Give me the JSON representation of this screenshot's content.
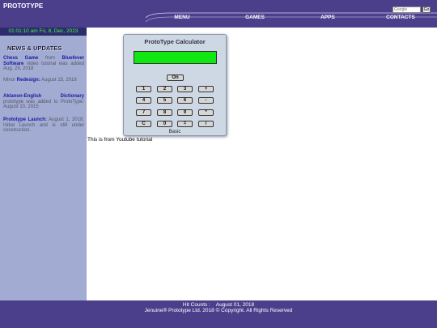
{
  "header": {
    "logo": "PROTOTYPE",
    "search_placeholder": "Google",
    "search_button": "Go",
    "nav": [
      "MENU",
      "GAMES",
      "APPS",
      "CONTACTS"
    ]
  },
  "sidebar": {
    "clock": "01:01:10 am Fri, 8, Dec, 2023",
    "news_title": "NEWS & UPDATES",
    "news": [
      {
        "hl1": "Chess Game",
        "t1": " from ",
        "hl2": "Bluefever Software",
        "t2": " video tutorial was added Aug. 29, 2018"
      },
      {
        "t0": "Minor ",
        "hl1": "Redesign:",
        "t1": " August 15, 2018"
      },
      {
        "hl1": "Aklanon-English Dictionary",
        "t1": " prototype was added to ProtoType: August 10, 2015"
      },
      {
        "hl1": "Prototype Launch:",
        "t1": " August 1, 2018. Initial Launch and is still under construction."
      }
    ]
  },
  "calculator": {
    "title": "ProtoType Calculator",
    "on_label": "On",
    "keys": [
      [
        "1",
        "2",
        "3",
        "+"
      ],
      [
        "4",
        "5",
        "6",
        "-"
      ],
      [
        "7",
        "8",
        "9",
        "*"
      ],
      [
        "C",
        "0",
        "=",
        "/"
      ]
    ],
    "mode": "Basic"
  },
  "main": {
    "note": "This is from Youtube tutorial"
  },
  "footer": {
    "hit_counts": "Hit Counts :    August 01, 2018",
    "copyright": "Jenuine® Prototype Ltd. 2018 © Copyright. All Rights Reserved"
  },
  "colors": {
    "header_bg": "#4b3f8c",
    "sidebar_bg": "#a2acd2",
    "display_green": "#11e811",
    "clock_green": "#3cff3c"
  }
}
